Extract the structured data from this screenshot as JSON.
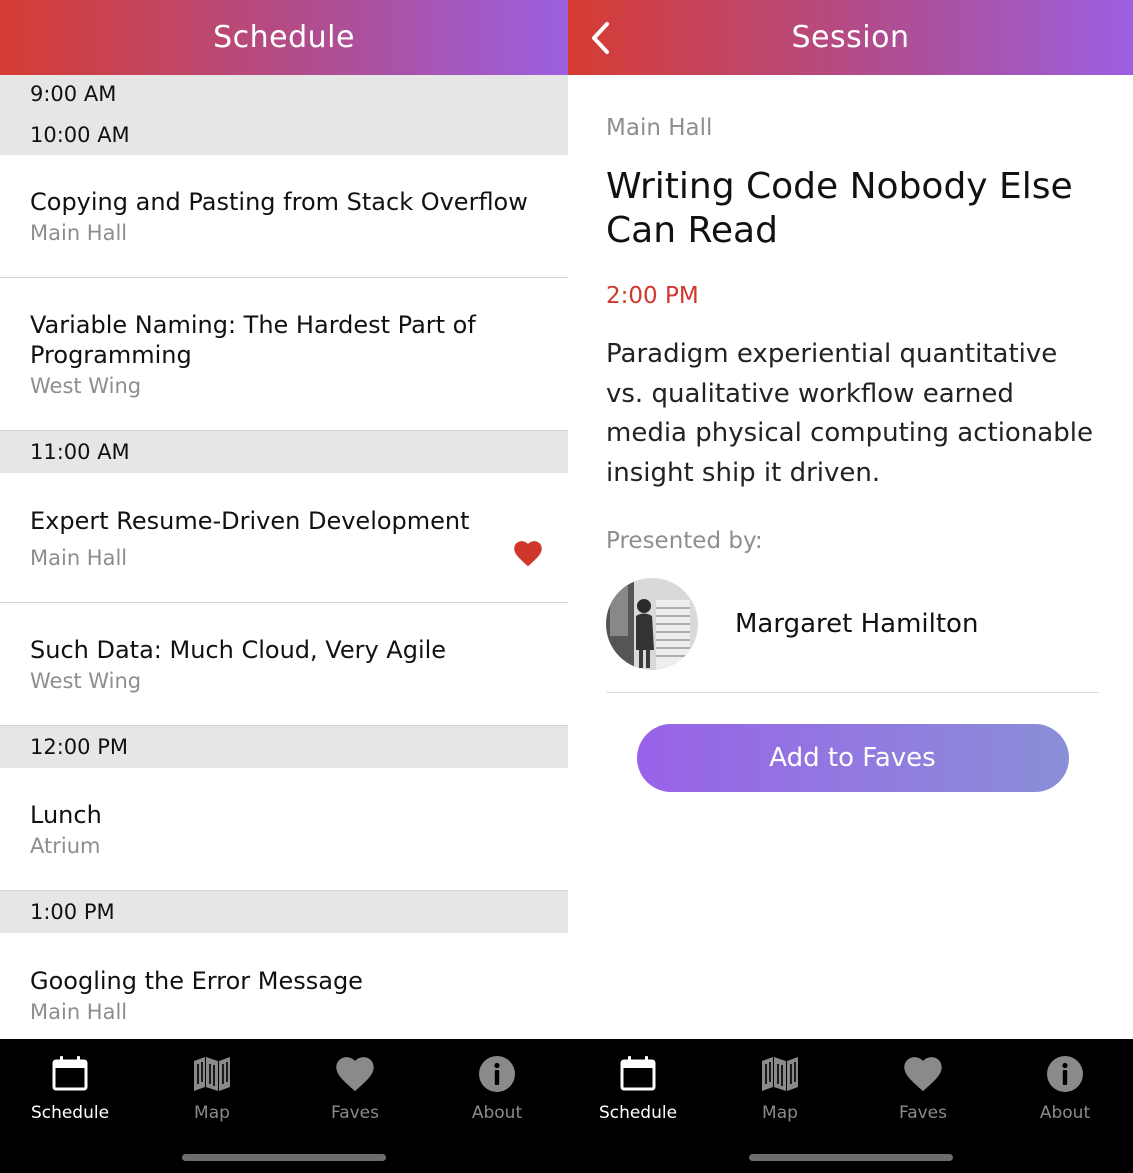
{
  "schedule_screen": {
    "title": "Schedule",
    "groups": [
      {
        "time_labels": [
          "9:00 AM",
          "10:00 AM"
        ],
        "sessions": [
          {
            "title": "Copying and Pasting from Stack Overflow",
            "room": "Main Hall",
            "faved": false
          },
          {
            "title": "Variable Naming: The Hardest Part of Programming",
            "room": "West Wing",
            "faved": false
          }
        ]
      },
      {
        "time_labels": [
          "11:00 AM"
        ],
        "sessions": [
          {
            "title": "Expert Resume-Driven Development",
            "room": "Main Hall",
            "faved": true
          },
          {
            "title": "Such Data: Much Cloud, Very Agile",
            "room": "West Wing",
            "faved": false
          }
        ]
      },
      {
        "time_labels": [
          "12:00 PM"
        ],
        "sessions": [
          {
            "title": "Lunch",
            "room": "Atrium",
            "faved": false
          }
        ]
      },
      {
        "time_labels": [
          "1:00 PM"
        ],
        "sessions": [
          {
            "title": "Googling the Error Message",
            "room": "Main Hall",
            "faved": false
          }
        ]
      }
    ]
  },
  "session_screen": {
    "title": "Session",
    "back_icon": "chevron-left-icon",
    "room": "Main Hall",
    "session_title": "Writing Code Nobody Else Can Read",
    "time": "2:00 PM",
    "description": "Paradigm experiential quantitative vs. qualitative workflow earned media physical computing actionable insight ship it driven.",
    "presented_by_label": "Presented by:",
    "speaker_name": "Margaret Hamilton",
    "add_button_label": "Add to Faves"
  },
  "tabbar": {
    "tabs": [
      {
        "label": "Schedule",
        "icon": "calendar-icon",
        "active": true
      },
      {
        "label": "Map",
        "icon": "map-icon",
        "active": false
      },
      {
        "label": "Faves",
        "icon": "heart-icon",
        "active": false
      },
      {
        "label": "About",
        "icon": "info-icon",
        "active": false
      }
    ]
  },
  "colors": {
    "header_gradient_start": "#d63c32",
    "header_gradient_end": "#9b5fe0",
    "accent_red": "#d0372c",
    "button_gradient_start": "#9962e8",
    "button_gradient_end": "#8a8fd8",
    "tabbar_bg": "#000000",
    "section_header_bg": "#e6e6e6"
  }
}
